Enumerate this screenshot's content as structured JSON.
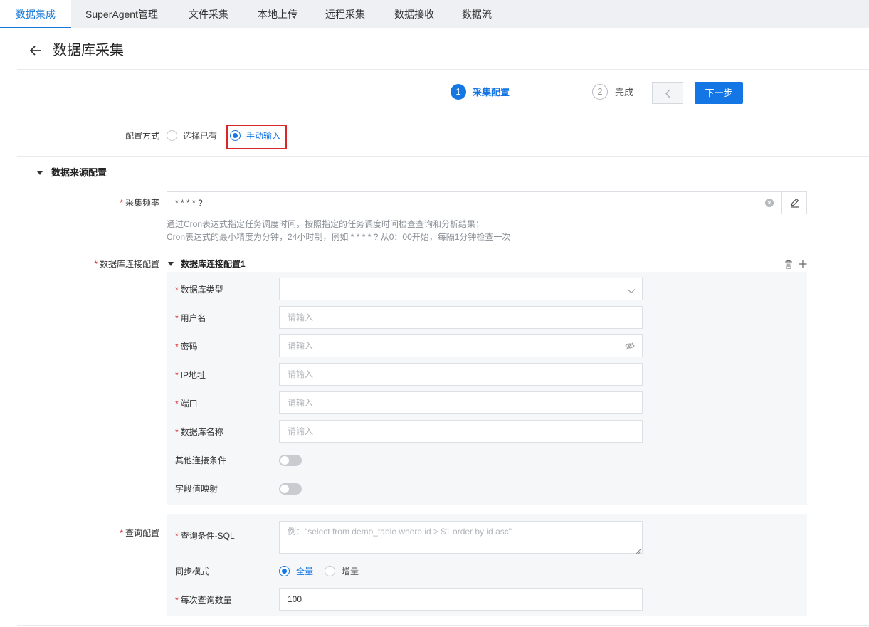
{
  "tabs": [
    "数据集成",
    "SuperAgent管理",
    "文件采集",
    "本地上传",
    "远程采集",
    "数据接收",
    "数据流"
  ],
  "page_title": "数据库采集",
  "steps": [
    {
      "num": "1",
      "label": "采集配置"
    },
    {
      "num": "2",
      "label": "完成"
    }
  ],
  "buttons": {
    "next": "下一步"
  },
  "config_mode": {
    "label": "配置方式",
    "options": [
      "选择已有",
      "手动输入"
    ],
    "selected": "手动输入"
  },
  "source_section": {
    "title": "数据来源配置"
  },
  "frequency": {
    "label": "采集频率",
    "value": "* * * * ?",
    "hint_line1": "通过Cron表达式指定任务调度时间，按照指定的任务调度时间检查查询和分析结果；",
    "hint_line2": "Cron表达式的最小精度为分钟，24小时制，例如 * * * * ? 从0：00开始，每隔1分钟检查一次"
  },
  "db_connection": {
    "label": "数据库连接配置",
    "sub_title": "数据库连接配置1",
    "fields": [
      {
        "label": "数据库类型",
        "placeholder": ""
      },
      {
        "label": "用户名",
        "placeholder": "请输入"
      },
      {
        "label": "密码",
        "placeholder": "请输入"
      },
      {
        "label": "IP地址",
        "placeholder": "请输入"
      },
      {
        "label": "端口",
        "placeholder": "请输入"
      },
      {
        "label": "数据库名称",
        "placeholder": "请输入"
      }
    ],
    "other_conditions_label": "其他连接条件",
    "field_mapping_label": "字段值映射"
  },
  "query_config": {
    "label": "查询配置",
    "sql_label": "查询条件-SQL",
    "sql_placeholder": "例：\"select from demo_table where id > $1 order by id asc\"",
    "sync_label": "同步模式",
    "sync_options": [
      "全量",
      "增量"
    ],
    "sync_selected": "全量",
    "batch_label": "每次查询数量",
    "batch_value": "100"
  },
  "colors": {
    "primary": "#1476e5",
    "required": "#e02020",
    "highlight": "#d9262b"
  }
}
